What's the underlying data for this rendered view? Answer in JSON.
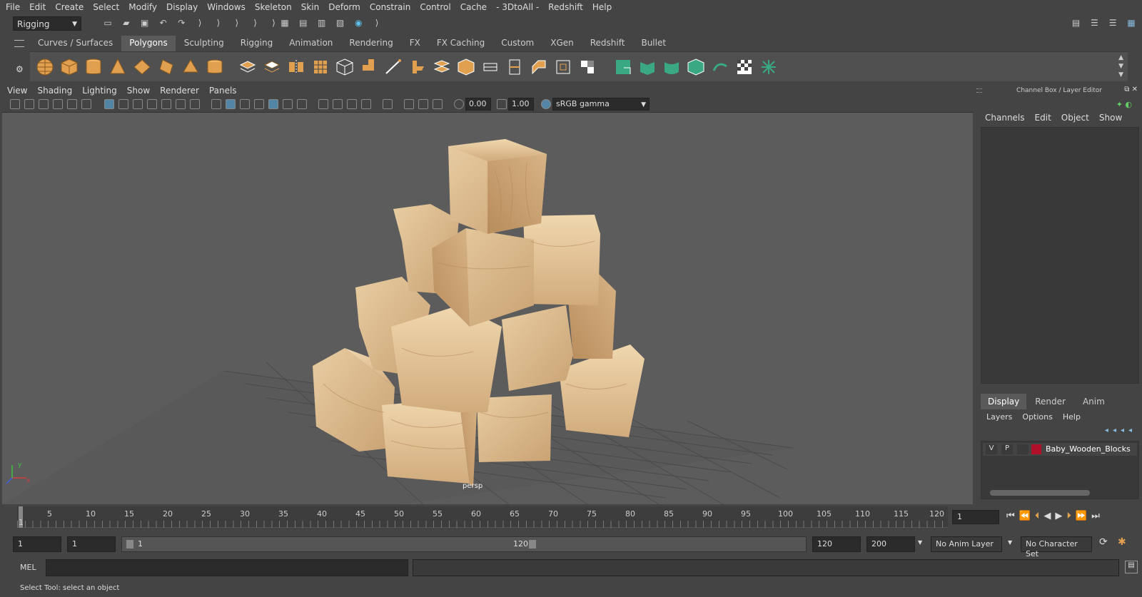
{
  "menubar": {
    "items": [
      "File",
      "Edit",
      "Create",
      "Select",
      "Modify",
      "Display",
      "Windows",
      "Skeleton",
      "Skin",
      "Deform",
      "Constrain",
      "Control",
      "Cache",
      "- 3DtoAll -",
      "Redshift",
      "Help"
    ]
  },
  "toolbar": {
    "workspace": "Rigging"
  },
  "shelf": {
    "tabs": [
      "Curves / Surfaces",
      "Polygons",
      "Sculpting",
      "Rigging",
      "Animation",
      "Rendering",
      "FX",
      "FX Caching",
      "Custom",
      "XGen",
      "Redshift",
      "Bullet"
    ],
    "active": "Polygons"
  },
  "panel": {
    "menu": [
      "View",
      "Shading",
      "Lighting",
      "Show",
      "Renderer",
      "Panels"
    ],
    "exposure": "0.00",
    "gamma": "1.00",
    "colorspace": "sRGB gamma",
    "camera": "persp"
  },
  "channelbox": {
    "title": "Channel Box / Layer Editor",
    "menu": [
      "Channels",
      "Edit",
      "Object",
      "Show"
    ]
  },
  "layers": {
    "tabs": [
      "Display",
      "Render",
      "Anim"
    ],
    "active": "Display",
    "menu": [
      "Layers",
      "Options",
      "Help"
    ],
    "row": {
      "v": "V",
      "p": "P",
      "name": "Baby_Wooden_Blocks",
      "color": "#b0102a"
    }
  },
  "timeline": {
    "ticks": [
      "5",
      "10",
      "15",
      "20",
      "25",
      "30",
      "35",
      "40",
      "45",
      "50",
      "55",
      "60",
      "65",
      "70",
      "75",
      "80",
      "85",
      "90",
      "95",
      "100",
      "105",
      "110",
      "115",
      "120"
    ],
    "first": "1",
    "current": "1"
  },
  "range": {
    "start": "1",
    "start2": "1",
    "slider_start": "1",
    "slider_end": "120",
    "end": "120",
    "end2": "200",
    "anim_layer": "No Anim Layer",
    "char_set": "No Character Set"
  },
  "mel": {
    "label": "MEL"
  },
  "status": {
    "text": "Select Tool: select an object"
  },
  "colors": {
    "accent": "#5285a6",
    "shelf_icon": "#e0a050",
    "shelf_icon_green": "#3aa882"
  }
}
